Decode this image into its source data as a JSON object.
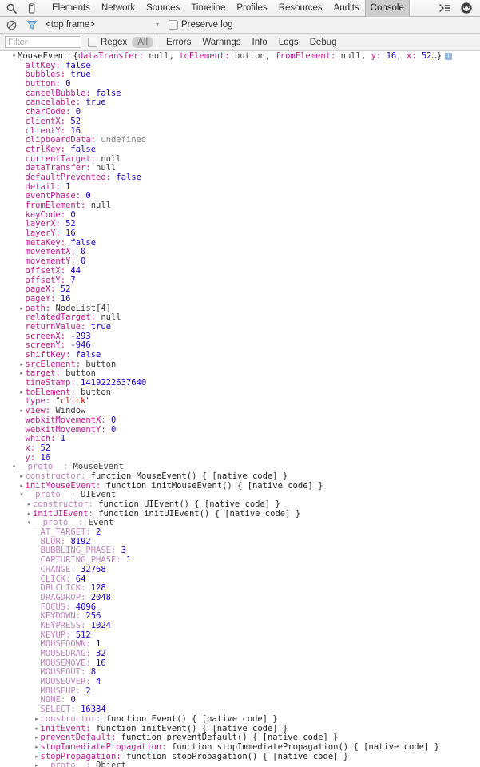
{
  "toolbar": {
    "tabs": [
      {
        "label": "Elements",
        "active": false
      },
      {
        "label": "Network",
        "active": false
      },
      {
        "label": "Sources",
        "active": false
      },
      {
        "label": "Timeline",
        "active": false
      },
      {
        "label": "Profiles",
        "active": false
      },
      {
        "label": "Resources",
        "active": false
      },
      {
        "label": "Audits",
        "active": false
      },
      {
        "label": "Console",
        "active": true
      }
    ],
    "search_icon": "search-icon",
    "device_icon": "device-toggle-icon",
    "drawer_icon": "show-drawer-icon",
    "settings_icon": "gear-icon"
  },
  "frame_bar": {
    "clear_icon": "clear-console-icon",
    "filter_icon": "filter-funnel-icon",
    "context_value": "<top frame>",
    "caret": "▾",
    "preserve_log_label": "Preserve log",
    "preserve_log_checked": false
  },
  "level_bar": {
    "filter_placeholder": "Filter",
    "filter_value": "",
    "regex_label": "Regex",
    "regex_checked": false,
    "levels": [
      {
        "label": "All",
        "active": true
      },
      {
        "label": "Errors",
        "active": false
      },
      {
        "label": "Warnings",
        "active": false
      },
      {
        "label": "Info",
        "active": false
      },
      {
        "label": "Logs",
        "active": false
      },
      {
        "label": "Debug",
        "active": false
      }
    ]
  },
  "console": {
    "header": {
      "tri": "▾",
      "type": "MouseEvent",
      "preview_open": " {",
      "preview": [
        {
          "key": "dataTransfer",
          "val": "null",
          "cls": "k-null"
        },
        {
          "key": "toElement",
          "val": "button",
          "cls": "k-null"
        },
        {
          "key": "fromElement",
          "val": "null",
          "cls": "k-null"
        },
        {
          "key": "y",
          "val": "16",
          "cls": "k-num"
        },
        {
          "key": "x",
          "val": "52",
          "cls": "k-num"
        }
      ],
      "preview_close": "…}",
      "badge": "i"
    },
    "rows": [
      {
        "indent": 1,
        "tri": "",
        "key": "altKey",
        "kcls": "k-prop",
        "val": "false",
        "vcls": "k-num"
      },
      {
        "indent": 1,
        "tri": "",
        "key": "bubbles",
        "kcls": "k-prop",
        "val": "true",
        "vcls": "k-num"
      },
      {
        "indent": 1,
        "tri": "",
        "key": "button",
        "kcls": "k-prop",
        "val": "0",
        "vcls": "k-num"
      },
      {
        "indent": 1,
        "tri": "",
        "key": "cancelBubble",
        "kcls": "k-prop",
        "val": "false",
        "vcls": "k-num"
      },
      {
        "indent": 1,
        "tri": "",
        "key": "cancelable",
        "kcls": "k-prop",
        "val": "true",
        "vcls": "k-num"
      },
      {
        "indent": 1,
        "tri": "",
        "key": "charCode",
        "kcls": "k-prop",
        "val": "0",
        "vcls": "k-num"
      },
      {
        "indent": 1,
        "tri": "",
        "key": "clientX",
        "kcls": "k-prop",
        "val": "52",
        "vcls": "k-num"
      },
      {
        "indent": 1,
        "tri": "",
        "key": "clientY",
        "kcls": "k-prop",
        "val": "16",
        "vcls": "k-num"
      },
      {
        "indent": 1,
        "tri": "",
        "key": "clipboardData",
        "kcls": "k-prop",
        "val": "undefined",
        "vcls": "k-undef"
      },
      {
        "indent": 1,
        "tri": "",
        "key": "ctrlKey",
        "kcls": "k-prop",
        "val": "false",
        "vcls": "k-num"
      },
      {
        "indent": 1,
        "tri": "",
        "key": "currentTarget",
        "kcls": "k-prop",
        "val": "null",
        "vcls": "k-null"
      },
      {
        "indent": 1,
        "tri": "",
        "key": "dataTransfer",
        "kcls": "k-prop",
        "val": "null",
        "vcls": "k-null"
      },
      {
        "indent": 1,
        "tri": "",
        "key": "defaultPrevented",
        "kcls": "k-prop",
        "val": "false",
        "vcls": "k-num"
      },
      {
        "indent": 1,
        "tri": "",
        "key": "detail",
        "kcls": "k-prop",
        "val": "1",
        "vcls": "k-num"
      },
      {
        "indent": 1,
        "tri": "",
        "key": "eventPhase",
        "kcls": "k-prop",
        "val": "0",
        "vcls": "k-num"
      },
      {
        "indent": 1,
        "tri": "",
        "key": "fromElement",
        "kcls": "k-prop",
        "val": "null",
        "vcls": "k-null"
      },
      {
        "indent": 1,
        "tri": "",
        "key": "keyCode",
        "kcls": "k-prop",
        "val": "0",
        "vcls": "k-num"
      },
      {
        "indent": 1,
        "tri": "",
        "key": "layerX",
        "kcls": "k-prop",
        "val": "52",
        "vcls": "k-num"
      },
      {
        "indent": 1,
        "tri": "",
        "key": "layerY",
        "kcls": "k-prop",
        "val": "16",
        "vcls": "k-num"
      },
      {
        "indent": 1,
        "tri": "",
        "key": "metaKey",
        "kcls": "k-prop",
        "val": "false",
        "vcls": "k-num"
      },
      {
        "indent": 1,
        "tri": "",
        "key": "movementX",
        "kcls": "k-prop",
        "val": "0",
        "vcls": "k-num"
      },
      {
        "indent": 1,
        "tri": "",
        "key": "movementY",
        "kcls": "k-prop",
        "val": "0",
        "vcls": "k-num"
      },
      {
        "indent": 1,
        "tri": "",
        "key": "offsetX",
        "kcls": "k-prop",
        "val": "44",
        "vcls": "k-num"
      },
      {
        "indent": 1,
        "tri": "",
        "key": "offsetY",
        "kcls": "k-prop",
        "val": "7",
        "vcls": "k-num"
      },
      {
        "indent": 1,
        "tri": "",
        "key": "pageX",
        "kcls": "k-prop",
        "val": "52",
        "vcls": "k-num"
      },
      {
        "indent": 1,
        "tri": "",
        "key": "pageY",
        "kcls": "k-prop",
        "val": "16",
        "vcls": "k-num"
      },
      {
        "indent": 1,
        "tri": "▸",
        "key": "path",
        "kcls": "k-prop",
        "val": "NodeList[4]",
        "vcls": "k-null"
      },
      {
        "indent": 1,
        "tri": "",
        "key": "relatedTarget",
        "kcls": "k-prop",
        "val": "null",
        "vcls": "k-null"
      },
      {
        "indent": 1,
        "tri": "",
        "key": "returnValue",
        "kcls": "k-prop",
        "val": "true",
        "vcls": "k-num"
      },
      {
        "indent": 1,
        "tri": "",
        "key": "screenX",
        "kcls": "k-prop",
        "val": "-293",
        "vcls": "k-num"
      },
      {
        "indent": 1,
        "tri": "",
        "key": "screenY",
        "kcls": "k-prop",
        "val": "-946",
        "vcls": "k-num"
      },
      {
        "indent": 1,
        "tri": "",
        "key": "shiftKey",
        "kcls": "k-prop",
        "val": "false",
        "vcls": "k-num"
      },
      {
        "indent": 1,
        "tri": "▸",
        "key": "srcElement",
        "kcls": "k-prop",
        "val": "button",
        "vcls": "k-null"
      },
      {
        "indent": 1,
        "tri": "▸",
        "key": "target",
        "kcls": "k-prop",
        "val": "button",
        "vcls": "k-null"
      },
      {
        "indent": 1,
        "tri": "",
        "key": "timeStamp",
        "kcls": "k-prop",
        "val": "1419222637640",
        "vcls": "k-num"
      },
      {
        "indent": 1,
        "tri": "▸",
        "key": "toElement",
        "kcls": "k-prop",
        "val": "button",
        "vcls": "k-null"
      },
      {
        "indent": 1,
        "tri": "",
        "key": "type",
        "kcls": "k-prop",
        "val": "\"click\"",
        "vcls": "k-str"
      },
      {
        "indent": 1,
        "tri": "▸",
        "key": "view",
        "kcls": "k-prop",
        "val": "Window",
        "vcls": "k-null"
      },
      {
        "indent": 1,
        "tri": "",
        "key": "webkitMovementX",
        "kcls": "k-prop",
        "val": "0",
        "vcls": "k-num"
      },
      {
        "indent": 1,
        "tri": "",
        "key": "webkitMovementY",
        "kcls": "k-prop",
        "val": "0",
        "vcls": "k-num"
      },
      {
        "indent": 1,
        "tri": "",
        "key": "which",
        "kcls": "k-prop",
        "val": "1",
        "vcls": "k-num"
      },
      {
        "indent": 1,
        "tri": "",
        "key": "x",
        "kcls": "k-prop",
        "val": "52",
        "vcls": "k-num"
      },
      {
        "indent": 1,
        "tri": "",
        "key": "y",
        "kcls": "k-prop",
        "val": "16",
        "vcls": "k-num"
      },
      {
        "indent": 0,
        "tri": "▾",
        "key": "__proto__",
        "kcls": "k-proto",
        "val": "MouseEvent",
        "vcls": "k-null"
      },
      {
        "indent": 1,
        "tri": "▸",
        "key": "constructor",
        "kcls": "k-proto",
        "val": "function MouseEvent() { [native code] }",
        "vcls": "k-plain"
      },
      {
        "indent": 1,
        "tri": "▸",
        "key": "initMouseEvent",
        "kcls": "k-prop",
        "val": "function initMouseEvent() { [native code] }",
        "vcls": "k-plain"
      },
      {
        "indent": 1,
        "tri": "▾",
        "key": "__proto__",
        "kcls": "k-proto",
        "val": "UIEvent",
        "vcls": "k-null"
      },
      {
        "indent": 2,
        "tri": "▸",
        "key": "constructor",
        "kcls": "k-proto",
        "val": "function UIEvent() { [native code] }",
        "vcls": "k-plain"
      },
      {
        "indent": 2,
        "tri": "▸",
        "key": "initUIEvent",
        "kcls": "k-prop",
        "val": "function initUIEvent() { [native code] }",
        "vcls": "k-plain"
      },
      {
        "indent": 2,
        "tri": "▾",
        "key": "__proto__",
        "kcls": "k-proto",
        "val": "Event",
        "vcls": "k-null"
      },
      {
        "indent": 3,
        "tri": "",
        "key": "AT_TARGET",
        "kcls": "k-proto",
        "val": "2",
        "vcls": "k-num"
      },
      {
        "indent": 3,
        "tri": "",
        "key": "BLUR",
        "kcls": "k-proto",
        "val": "8192",
        "vcls": "k-num"
      },
      {
        "indent": 3,
        "tri": "",
        "key": "BUBBLING_PHASE",
        "kcls": "k-proto",
        "val": "3",
        "vcls": "k-num"
      },
      {
        "indent": 3,
        "tri": "",
        "key": "CAPTURING_PHASE",
        "kcls": "k-proto",
        "val": "1",
        "vcls": "k-num"
      },
      {
        "indent": 3,
        "tri": "",
        "key": "CHANGE",
        "kcls": "k-proto",
        "val": "32768",
        "vcls": "k-num"
      },
      {
        "indent": 3,
        "tri": "",
        "key": "CLICK",
        "kcls": "k-proto",
        "val": "64",
        "vcls": "k-num"
      },
      {
        "indent": 3,
        "tri": "",
        "key": "DBLCLICK",
        "kcls": "k-proto",
        "val": "128",
        "vcls": "k-num"
      },
      {
        "indent": 3,
        "tri": "",
        "key": "DRAGDROP",
        "kcls": "k-proto",
        "val": "2048",
        "vcls": "k-num"
      },
      {
        "indent": 3,
        "tri": "",
        "key": "FOCUS",
        "kcls": "k-proto",
        "val": "4096",
        "vcls": "k-num"
      },
      {
        "indent": 3,
        "tri": "",
        "key": "KEYDOWN",
        "kcls": "k-proto",
        "val": "256",
        "vcls": "k-num"
      },
      {
        "indent": 3,
        "tri": "",
        "key": "KEYPRESS",
        "kcls": "k-proto",
        "val": "1024",
        "vcls": "k-num"
      },
      {
        "indent": 3,
        "tri": "",
        "key": "KEYUP",
        "kcls": "k-proto",
        "val": "512",
        "vcls": "k-num"
      },
      {
        "indent": 3,
        "tri": "",
        "key": "MOUSEDOWN",
        "kcls": "k-proto",
        "val": "1",
        "vcls": "k-num"
      },
      {
        "indent": 3,
        "tri": "",
        "key": "MOUSEDRAG",
        "kcls": "k-proto",
        "val": "32",
        "vcls": "k-num"
      },
      {
        "indent": 3,
        "tri": "",
        "key": "MOUSEMOVE",
        "kcls": "k-proto",
        "val": "16",
        "vcls": "k-num"
      },
      {
        "indent": 3,
        "tri": "",
        "key": "MOUSEOUT",
        "kcls": "k-proto",
        "val": "8",
        "vcls": "k-num"
      },
      {
        "indent": 3,
        "tri": "",
        "key": "MOUSEOVER",
        "kcls": "k-proto",
        "val": "4",
        "vcls": "k-num"
      },
      {
        "indent": 3,
        "tri": "",
        "key": "MOUSEUP",
        "kcls": "k-proto",
        "val": "2",
        "vcls": "k-num"
      },
      {
        "indent": 3,
        "tri": "",
        "key": "NONE",
        "kcls": "k-proto",
        "val": "0",
        "vcls": "k-num"
      },
      {
        "indent": 3,
        "tri": "",
        "key": "SELECT",
        "kcls": "k-proto",
        "val": "16384",
        "vcls": "k-num"
      },
      {
        "indent": 3,
        "tri": "▸",
        "key": "constructor",
        "kcls": "k-proto",
        "val": "function Event() { [native code] }",
        "vcls": "k-plain"
      },
      {
        "indent": 3,
        "tri": "▸",
        "key": "initEvent",
        "kcls": "k-prop",
        "val": "function initEvent() { [native code] }",
        "vcls": "k-plain"
      },
      {
        "indent": 3,
        "tri": "▸",
        "key": "preventDefault",
        "kcls": "k-prop",
        "val": "function preventDefault() { [native code] }",
        "vcls": "k-plain"
      },
      {
        "indent": 3,
        "tri": "▸",
        "key": "stopImmediatePropagation",
        "kcls": "k-prop",
        "val": "function stopImmediatePropagation() { [native code] }",
        "vcls": "k-plain"
      },
      {
        "indent": 3,
        "tri": "▸",
        "key": "stopPropagation",
        "kcls": "k-prop",
        "val": "function stopPropagation() { [native code] }",
        "vcls": "k-plain"
      },
      {
        "indent": 3,
        "tri": "▸",
        "key": "__proto__",
        "kcls": "k-proto",
        "val": "Object",
        "vcls": "k-null"
      }
    ]
  }
}
